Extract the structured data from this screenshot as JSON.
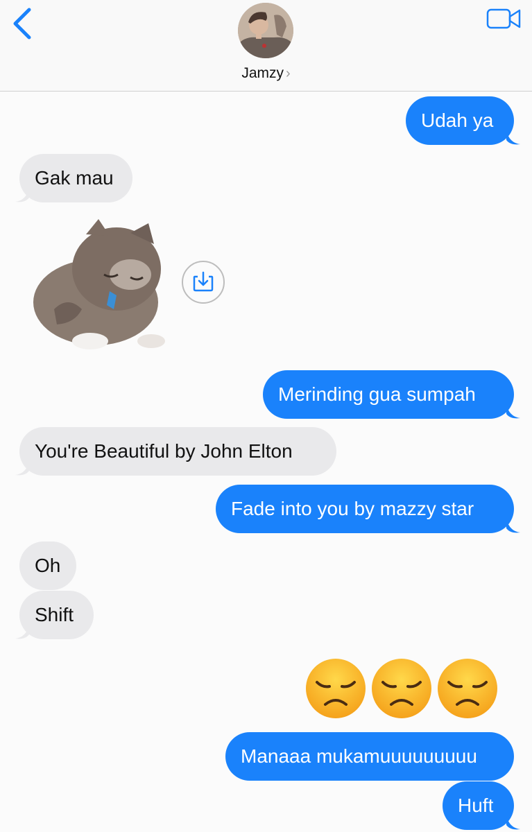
{
  "header": {
    "contact_name": "Jamzy",
    "chevron": "›",
    "back_icon": "chevron-left-icon",
    "video_icon": "video-camera-icon"
  },
  "colors": {
    "outgoing_bubble": "#1a82fb",
    "incoming_bubble": "#e9e9eb",
    "accent": "#1a82fb"
  },
  "messages": [
    {
      "direction": "out",
      "text": "Udah ya"
    },
    {
      "direction": "in",
      "text": "Gak mau"
    },
    {
      "direction": "in",
      "type": "sticker",
      "sticker": "crying-kitten"
    },
    {
      "direction": "out",
      "text": "Merinding gua sumpah"
    },
    {
      "direction": "in",
      "text": "You're Beautiful by John Elton"
    },
    {
      "direction": "out",
      "text": "Fade into you by mazzy star"
    },
    {
      "direction": "in",
      "text": "Oh"
    },
    {
      "direction": "in",
      "text": "Shift"
    },
    {
      "direction": "out",
      "type": "emoji",
      "emoji": [
        "disappointed-face",
        "disappointed-face",
        "disappointed-face"
      ]
    },
    {
      "direction": "out",
      "text": "Manaaa mukamuuuuuuuuu"
    },
    {
      "direction": "out",
      "text": "Huft"
    }
  ]
}
